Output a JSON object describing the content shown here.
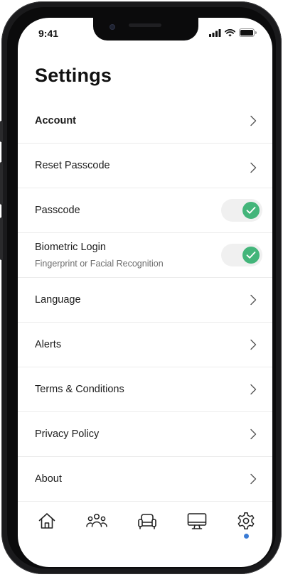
{
  "status_bar": {
    "time": "9:41"
  },
  "header": {
    "title": "Settings"
  },
  "settings": {
    "items": [
      {
        "label": "Account",
        "type": "link",
        "bold": true
      },
      {
        "label": "Reset Passcode",
        "type": "link"
      },
      {
        "label": "Passcode",
        "type": "toggle",
        "enabled": true
      },
      {
        "label": "Biometric Login",
        "sublabel": "Fingerprint or Facial Recognition",
        "type": "toggle",
        "enabled": true
      },
      {
        "label": "Language",
        "type": "link"
      },
      {
        "label": "Alerts",
        "type": "link"
      },
      {
        "label": "Terms & Conditions",
        "type": "link"
      },
      {
        "label": "Privacy Policy",
        "type": "link"
      },
      {
        "label": "About",
        "type": "link"
      }
    ]
  },
  "tabbar": {
    "tabs": [
      {
        "icon": "home-icon"
      },
      {
        "icon": "people-icon"
      },
      {
        "icon": "seat-icon"
      },
      {
        "icon": "monitor-icon"
      },
      {
        "icon": "gear-icon",
        "active": true
      }
    ]
  },
  "colors": {
    "toggle_on": "#43b57a",
    "active_dot": "#3a7bd5",
    "text": "#1c1c1c",
    "sublabel": "#6d6d6d"
  }
}
